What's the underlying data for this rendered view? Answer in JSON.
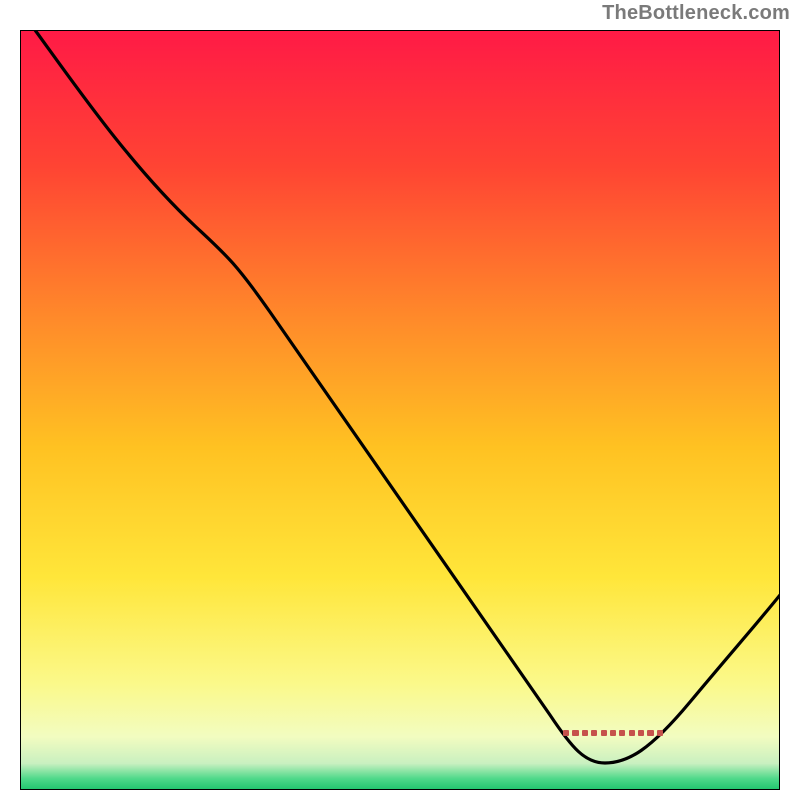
{
  "watermark": "TheBottleneck.com",
  "chart_data": {
    "type": "line",
    "title": "",
    "xlabel": "",
    "ylabel": "",
    "xlim": [
      0,
      100
    ],
    "ylim": [
      0,
      100
    ],
    "background_gradient": {
      "stops": [
        {
          "pos": 0.0,
          "color": "#ff1a46"
        },
        {
          "pos": 0.18,
          "color": "#ff4433"
        },
        {
          "pos": 0.38,
          "color": "#ff8a2a"
        },
        {
          "pos": 0.55,
          "color": "#ffc222"
        },
        {
          "pos": 0.72,
          "color": "#ffe63a"
        },
        {
          "pos": 0.86,
          "color": "#fbf98a"
        },
        {
          "pos": 0.93,
          "color": "#f2fcc0"
        },
        {
          "pos": 0.965,
          "color": "#c9f0c0"
        },
        {
          "pos": 0.985,
          "color": "#4fd98a"
        },
        {
          "pos": 1.0,
          "color": "#1fc56d"
        }
      ]
    },
    "series": [
      {
        "name": "bottleneck-curve",
        "color": "#000000",
        "x": [
          2,
          10,
          20,
          26,
          40,
          55,
          70,
          75,
          82,
          88,
          100
        ],
        "y": [
          100,
          90.5,
          79,
          72,
          51,
          30,
          9.5,
          3.5,
          3.5,
          10,
          24
        ]
      }
    ],
    "marker_segment": {
      "name": "optimal-range",
      "color": "#c6524c",
      "x_start": 73,
      "x_end": 86,
      "y": 4
    }
  }
}
